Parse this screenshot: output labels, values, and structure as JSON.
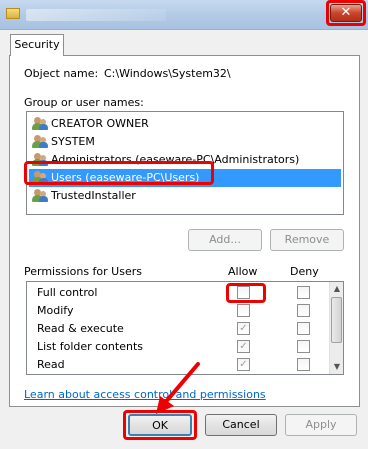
{
  "titlebar": {
    "close_label": "✕"
  },
  "tab": {
    "label": "Security"
  },
  "object": {
    "label": "Object name:",
    "value": "C:\\Windows\\System32\\"
  },
  "groups": {
    "label": "Group or user names:",
    "items": [
      {
        "label": "CREATOR OWNER"
      },
      {
        "label": "SYSTEM"
      },
      {
        "label": "Administrators (easeware-PC\\Administrators)"
      },
      {
        "label": "Users (easeware-PC\\Users)",
        "selected": true
      },
      {
        "label": "TrustedInstaller"
      }
    ]
  },
  "buttons": {
    "add": "Add...",
    "remove": "Remove",
    "ok": "OK",
    "cancel": "Cancel",
    "apply": "Apply"
  },
  "permissions": {
    "label": "Permissions for Users",
    "allow_label": "Allow",
    "deny_label": "Deny",
    "rows": [
      {
        "label": "Full control",
        "allow": false,
        "deny": false
      },
      {
        "label": "Modify",
        "allow": false,
        "deny": false
      },
      {
        "label": "Read & execute",
        "allow": true,
        "deny": false
      },
      {
        "label": "List folder contents",
        "allow": true,
        "deny": false
      },
      {
        "label": "Read",
        "allow": true,
        "deny": false
      }
    ]
  },
  "link": {
    "label": "Learn about access control and permissions"
  },
  "colors": {
    "highlight": "#ee0000",
    "selection": "#3399ff",
    "link": "#0066cc"
  }
}
